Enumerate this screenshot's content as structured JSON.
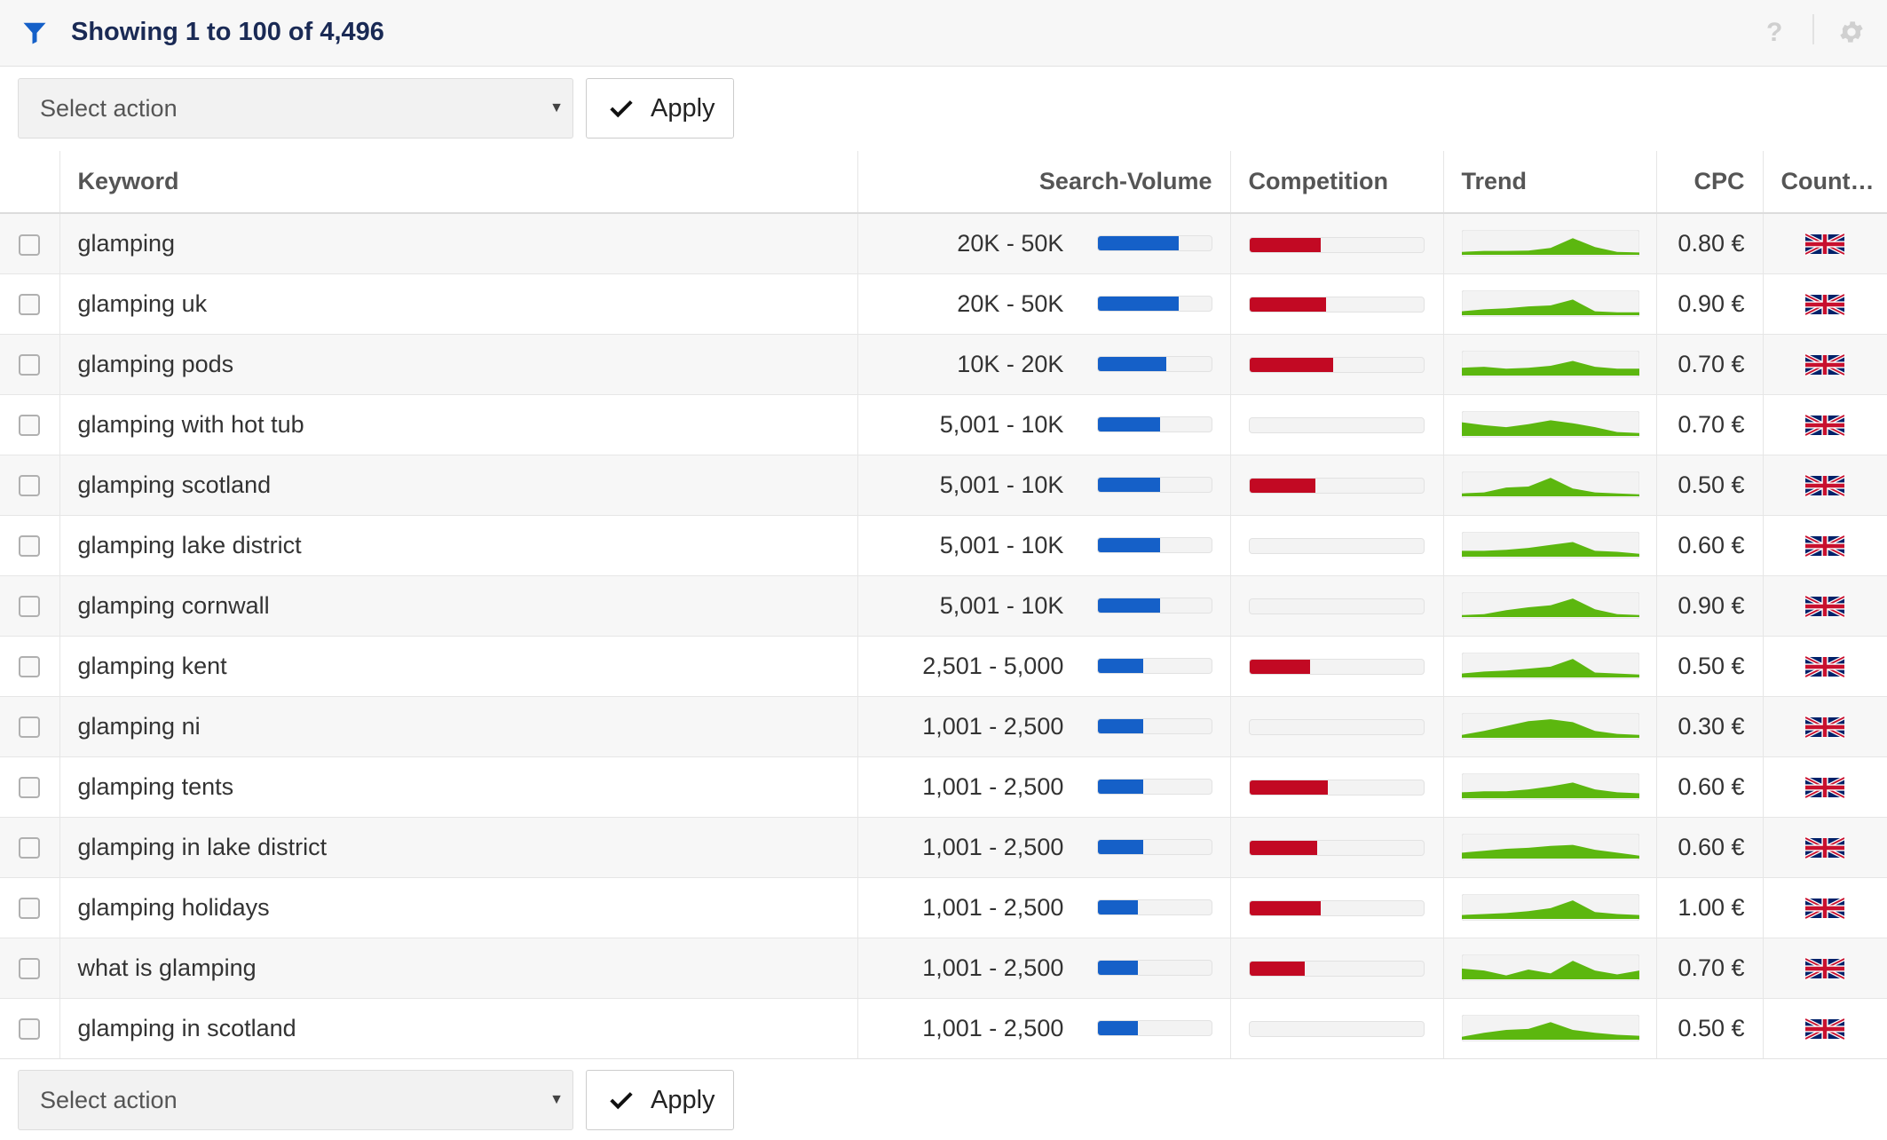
{
  "header": {
    "showing_text": "Showing 1 to 100 of 4,496",
    "filter_icon": "filter-icon",
    "help_label": "?",
    "settings_icon": "gear-icon"
  },
  "actions": {
    "select_placeholder": "Select action",
    "apply_label": "Apply"
  },
  "colors": {
    "search_volume": "#1560c8",
    "competition": "#c20923",
    "trend": "#5cb70f"
  },
  "table": {
    "columns": [
      "",
      "Keyword",
      "Search-Volume",
      "Competition",
      "Trend",
      "CPC",
      "Count…"
    ],
    "rows": [
      {
        "keyword": "glamping",
        "volume": "20K - 50K",
        "volume_level": 0.71,
        "competition": 0.41,
        "trend": [
          0.15,
          0.2,
          0.2,
          0.22,
          0.35,
          0.85,
          0.4,
          0.15,
          0.12
        ],
        "cpc": "0.80 €",
        "country": "uk-flag"
      },
      {
        "keyword": "glamping uk",
        "volume": "20K - 50K",
        "volume_level": 0.71,
        "competition": 0.44,
        "trend": [
          0.2,
          0.3,
          0.35,
          0.45,
          0.5,
          0.8,
          0.2,
          0.15,
          0.15
        ],
        "cpc": "0.90 €",
        "country": "uk-flag"
      },
      {
        "keyword": "glamping pods",
        "volume": "10K - 20K",
        "volume_level": 0.6,
        "competition": 0.48,
        "trend": [
          0.4,
          0.45,
          0.35,
          0.4,
          0.5,
          0.75,
          0.45,
          0.35,
          0.35
        ],
        "cpc": "0.70 €",
        "country": "uk-flag"
      },
      {
        "keyword": "glamping with hot tub",
        "volume": "5,001 - 10K",
        "volume_level": 0.55,
        "competition": 0.0,
        "trend": [
          0.7,
          0.55,
          0.45,
          0.6,
          0.8,
          0.65,
          0.45,
          0.2,
          0.15
        ],
        "cpc": "0.70 €",
        "country": "uk-flag"
      },
      {
        "keyword": "glamping scotland",
        "volume": "5,001 - 10K",
        "volume_level": 0.55,
        "competition": 0.38,
        "trend": [
          0.15,
          0.2,
          0.45,
          0.5,
          0.95,
          0.4,
          0.2,
          0.15,
          0.1
        ],
        "cpc": "0.50 €",
        "country": "uk-flag"
      },
      {
        "keyword": "glamping lake district",
        "volume": "5,001 - 10K",
        "volume_level": 0.55,
        "competition": 0.0,
        "trend": [
          0.3,
          0.3,
          0.35,
          0.45,
          0.6,
          0.75,
          0.3,
          0.25,
          0.15
        ],
        "cpc": "0.60 €",
        "country": "uk-flag"
      },
      {
        "keyword": "glamping cornwall",
        "volume": "5,001 - 10K",
        "volume_level": 0.55,
        "competition": 0.0,
        "trend": [
          0.1,
          0.15,
          0.35,
          0.5,
          0.6,
          0.95,
          0.4,
          0.15,
          0.1
        ],
        "cpc": "0.90 €",
        "country": "uk-flag"
      },
      {
        "keyword": "glamping kent",
        "volume": "2,501 - 5,000",
        "volume_level": 0.4,
        "competition": 0.35,
        "trend": [
          0.2,
          0.3,
          0.35,
          0.45,
          0.55,
          0.95,
          0.25,
          0.2,
          0.15
        ],
        "cpc": "0.50 €",
        "country": "uk-flag"
      },
      {
        "keyword": "glamping ni",
        "volume": "1,001 - 2,500",
        "volume_level": 0.4,
        "competition": 0.0,
        "trend": [
          0.15,
          0.35,
          0.6,
          0.85,
          0.95,
          0.8,
          0.35,
          0.2,
          0.15
        ],
        "cpc": "0.30 €",
        "country": "uk-flag"
      },
      {
        "keyword": "glamping tents",
        "volume": "1,001 - 2,500",
        "volume_level": 0.4,
        "competition": 0.45,
        "trend": [
          0.3,
          0.35,
          0.35,
          0.45,
          0.6,
          0.8,
          0.45,
          0.3,
          0.25
        ],
        "cpc": "0.60 €",
        "country": "uk-flag"
      },
      {
        "keyword": "glamping in lake district",
        "volume": "1,001 - 2,500",
        "volume_level": 0.4,
        "competition": 0.39,
        "trend": [
          0.3,
          0.4,
          0.5,
          0.55,
          0.65,
          0.7,
          0.45,
          0.3,
          0.15
        ],
        "cpc": "0.60 €",
        "country": "uk-flag"
      },
      {
        "keyword": "glamping holidays",
        "volume": "1,001 - 2,500",
        "volume_level": 0.35,
        "competition": 0.41,
        "trend": [
          0.2,
          0.25,
          0.3,
          0.4,
          0.55,
          0.95,
          0.35,
          0.25,
          0.2
        ],
        "cpc": "1.00 €",
        "country": "uk-flag"
      },
      {
        "keyword": "what is glamping",
        "volume": "1,001 - 2,500",
        "volume_level": 0.35,
        "competition": 0.32,
        "trend": [
          0.55,
          0.45,
          0.2,
          0.5,
          0.3,
          0.95,
          0.45,
          0.25,
          0.45
        ],
        "cpc": "0.70 €",
        "country": "uk-flag"
      },
      {
        "keyword": "glamping in scotland",
        "volume": "1,001 - 2,500",
        "volume_level": 0.35,
        "competition": 0.0,
        "trend": [
          0.15,
          0.35,
          0.5,
          0.55,
          0.9,
          0.5,
          0.35,
          0.25,
          0.2
        ],
        "cpc": "0.50 €",
        "country": "uk-flag"
      }
    ]
  },
  "footer_actions": {
    "select_placeholder": "Select action",
    "apply_label": "Apply"
  }
}
